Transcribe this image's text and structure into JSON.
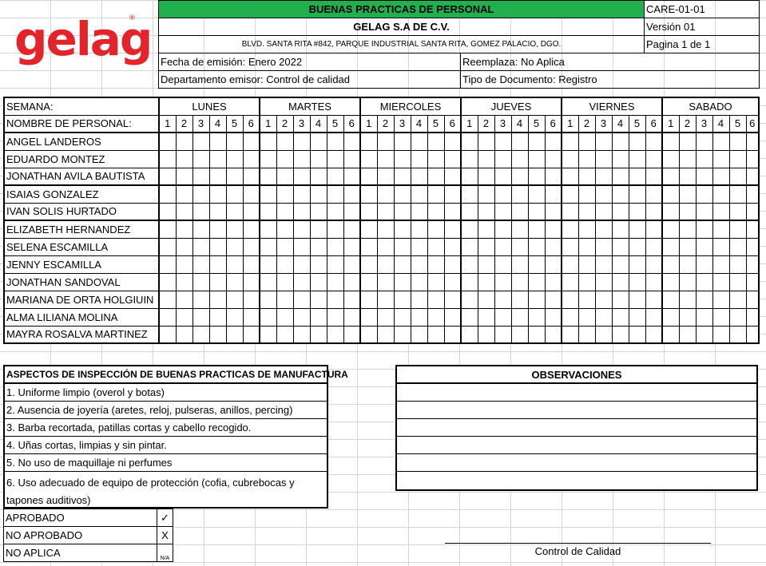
{
  "logo": {
    "text": "gelag",
    "reg_mark": "®",
    "color": "#e3242b"
  },
  "header": {
    "doc_title": "BUENAS PRACTICAS DE PERSONAL",
    "code": "CARE-01-01",
    "company": "GELAG S.A DE C.V.",
    "version": "Versión 01",
    "address": "BLVD. SANTA RITA #842, PARQUE INDUSTRIAL SANTA RITA, GOMEZ PALACIO, DGO.",
    "page": "Pagina 1 de 1",
    "issue_date": "Fecha de emisión: Enero 2022",
    "replaces": "Reemplaza: No Aplica",
    "department": "Departamento emisor: Control de calidad",
    "doc_type": "Tipo de Documento: Registro",
    "title_bg": "#22b04e"
  },
  "grid": {
    "week_label": "SEMANA:",
    "name_label": "NOMBRE DE PERSONAL:",
    "days": [
      "LUNES",
      "MARTES",
      "MIERCOLES",
      "JUEVES",
      "VIERNES",
      "SABADO"
    ],
    "slots": [
      "1",
      "2",
      "3",
      "4",
      "5",
      "6"
    ],
    "staff": [
      "ANGEL LANDEROS",
      "EDUARDO MONTEZ",
      "JONATHAN AVILA BAUTISTA",
      "ISAIAS GONZALEZ",
      "IVAN SOLIS HURTADO",
      "ELIZABETH HERNANDEZ",
      "SELENA ESCAMILLA",
      "JENNY ESCAMILLA",
      "JONATHAN SANDOVAL",
      "MARIANA DE ORTA HOLGIUIN",
      "ALMA LILIANA MOLINA",
      "MAYRA ROSALVA MARTINEZ"
    ]
  },
  "aspects": {
    "title": "ASPECTOS DE INSPECCIÓN DE BUENAS PRACTICAS DE MANUFACTURA",
    "items": [
      "1. Uniforme limpio (overol y botas)",
      "2. Ausencia de joyería (aretes, reloj, pulseras, anillos, percing)",
      "3. Barba recortada, patillas cortas y cabello recogido.",
      "4. Uñas cortas, limpias y sin pintar.",
      "5. No uso de maquillaje ni perfumes",
      "6. Uso adecuado de equipo de protección (cofia, cubrebocas y tapones auditivos)"
    ]
  },
  "observations": {
    "title": "OBSERVACIONES",
    "lines": 6
  },
  "legend": [
    {
      "label": "APROBADO",
      "symbol": "✓"
    },
    {
      "label": "NO APROBADO",
      "symbol": "X"
    },
    {
      "label": "NO APLICA",
      "symbol": "N/A"
    }
  ],
  "signature": {
    "label": "Control de Calidad"
  }
}
